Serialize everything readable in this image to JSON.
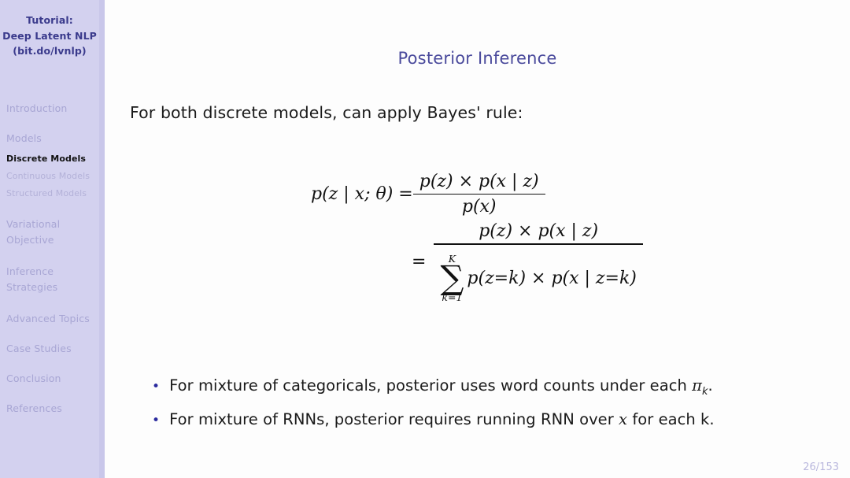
{
  "sidebar": {
    "title_lines": [
      "Tutorial:",
      "Deep Latent NLP",
      "(bit.do/lvnlp)"
    ],
    "items": [
      {
        "label": "Introduction",
        "level": "top",
        "active": false
      },
      {
        "label": "Models",
        "level": "top",
        "active": false
      },
      {
        "label": "Discrete Models",
        "level": "sub",
        "active": true
      },
      {
        "label": "Continuous Models",
        "level": "sub",
        "active": false
      },
      {
        "label": "Structured Models",
        "level": "sub",
        "active": false
      },
      {
        "label": "Variational",
        "level": "top",
        "active": false
      },
      {
        "label": "Objective",
        "level": "top",
        "active": false
      },
      {
        "label": "Inference",
        "level": "top",
        "active": false
      },
      {
        "label": "Strategies",
        "level": "top",
        "active": false
      },
      {
        "label": "Advanced Topics",
        "level": "top",
        "active": false
      },
      {
        "label": "Case Studies",
        "level": "top",
        "active": false
      },
      {
        "label": "Conclusion",
        "level": "top",
        "active": false
      },
      {
        "label": "References",
        "level": "top",
        "active": false
      }
    ]
  },
  "main": {
    "title": "Posterior Inference",
    "lead_text": "For both discrete models, can apply Bayes' rule:",
    "equation": {
      "lhs": "p(z | x; θ) =",
      "line1": {
        "numerator": "p(z) × p(x | z)",
        "denominator": "p(x)"
      },
      "line2": {
        "equals": "=",
        "numerator": "p(z) × p(x | z)",
        "sum_upper": "K",
        "sum_lower": "k=1",
        "sum_symbol": "∑",
        "sum_body": "p(z=k) × p(x | z=k)"
      }
    },
    "bullets": [
      {
        "marker": "•",
        "text_before": "For mixture of categoricals, posterior uses word counts under each ",
        "symbol": "π",
        "symbol_sub": "k",
        "text_after": "."
      },
      {
        "marker": "•",
        "text_before": "For mixture of RNNs, posterior requires running RNN over ",
        "symbol": "x",
        "symbol_sub": "",
        "text_after": " for each k."
      }
    ]
  },
  "footer": {
    "page_number": "26/153"
  },
  "colors": {
    "sidebar_bg": "#d3d1ef",
    "sidebar_edge": "#c9c7ea",
    "sidebar_title": "#3a3a8c",
    "nav_inactive": "#a8a6d4",
    "nav_active": "#111111",
    "title": "#4a4a9c",
    "bullet_marker": "#2a2a9e",
    "page_number": "#b9b7dd",
    "background": "#fdfdfd"
  }
}
